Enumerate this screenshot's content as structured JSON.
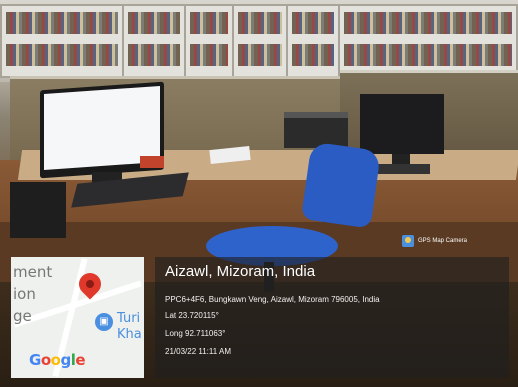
{
  "overlay": {
    "camera_badge": "GPS Map Camera",
    "location_title": "Aizawl, Mizoram, India",
    "address": "PPC6+4F6, Bungkawn Veng, Aizawl, Mizoram 796005, India",
    "latitude": "Lat 23.720115°",
    "longitude": "Long 92.711063°",
    "datetime": "21/03/22 11:11 AM"
  },
  "map": {
    "labels": [
      "ment",
      "ion",
      "ge",
      "Turi",
      "Kha"
    ],
    "brand": "Google",
    "brand_colors": [
      "#4285F4",
      "#EA4335",
      "#FBBC05",
      "#4285F4",
      "#34A853",
      "#EA4335"
    ],
    "pin_color": "#e0392b",
    "poi_color": "#4a8fe0"
  }
}
